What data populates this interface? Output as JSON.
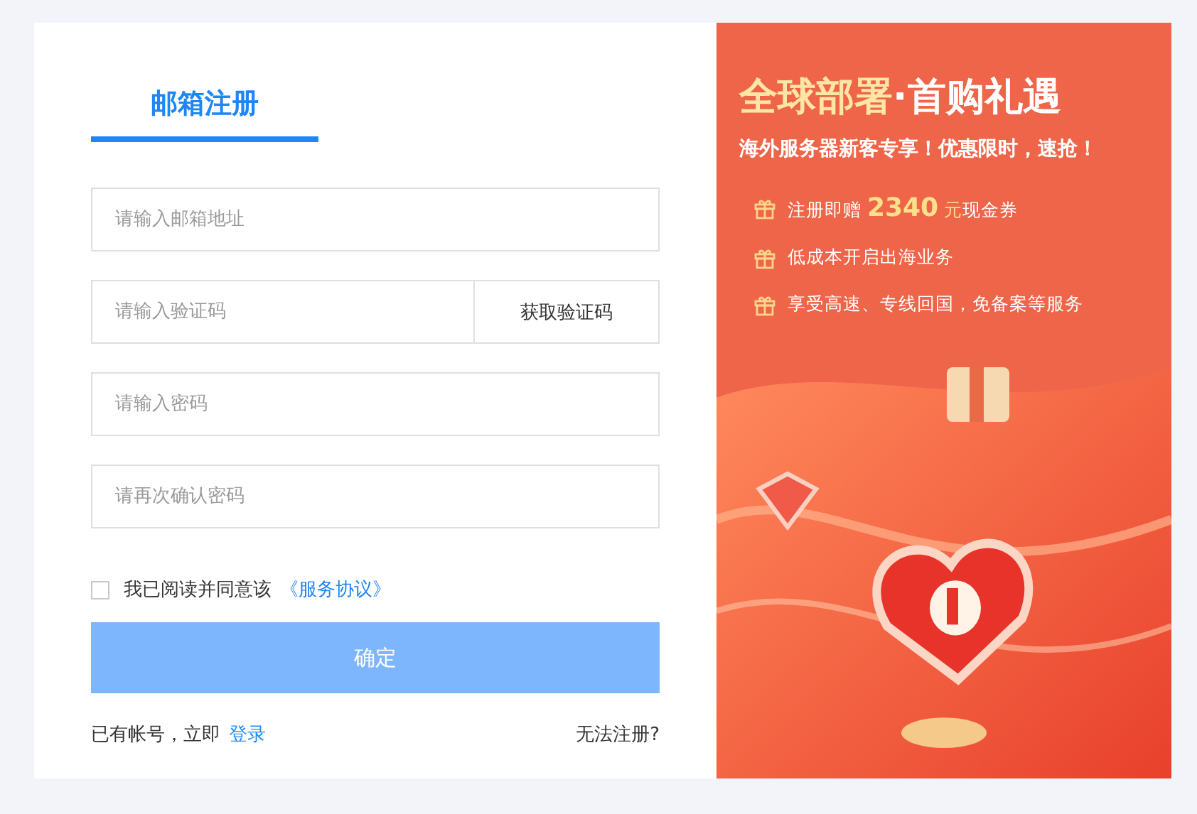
{
  "tabs": [
    {
      "label": "邮箱注册",
      "selected": true
    }
  ],
  "form": {
    "fields": [
      {
        "kind": "text",
        "placeholder": "请输入邮箱地址"
      },
      {
        "kind": "code",
        "placeholder": "请输入验证码",
        "button": "获取验证码"
      },
      {
        "kind": "password",
        "placeholder": "请输入密码"
      },
      {
        "kind": "password",
        "placeholder": "请再次确认密码"
      }
    ],
    "agreement": {
      "checked": false,
      "text": "我已阅读并同意该",
      "link": "《服务协议》"
    },
    "submit": {
      "label": "确定",
      "disabled": true
    },
    "footer": {
      "text": "已有帐号，立即",
      "link": "登录",
      "help": "无法注册?"
    }
  },
  "promo": {
    "title_highlight": "全球部署",
    "title_rest": "·首购礼遇",
    "subtitle": "海外服务器新客专享！优惠限时，速抢！",
    "perks": [
      {
        "kind": "amount",
        "prefix": "注册即赠",
        "amount": "2340",
        "unit": "元",
        "suffix": "现金券"
      },
      {
        "kind": "plain",
        "text": "低成本开启出海业务"
      },
      {
        "kind": "plain",
        "text": "享受高速、专线回国，免备案等服务"
      }
    ]
  }
}
